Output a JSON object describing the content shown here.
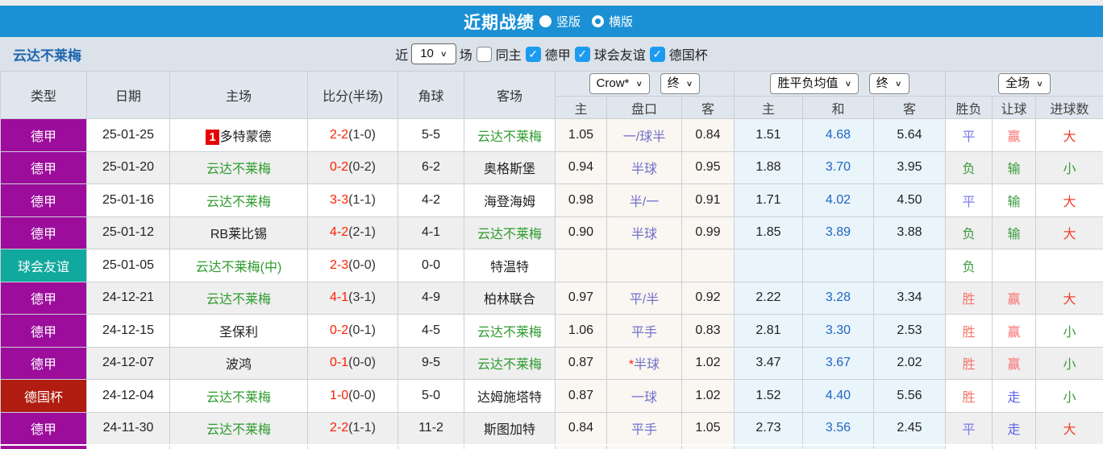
{
  "topbar": {
    "title": "近期战绩",
    "vertical_label": "竖版",
    "horizontal_label": "横版",
    "selected_layout": "竖版"
  },
  "filterbar": {
    "team": "云达不莱梅",
    "recent_label": "近",
    "count_value": "10",
    "matches_label": "场",
    "same_venue_label": "同主",
    "same_venue_checked": false,
    "leagues": [
      {
        "label": "德甲",
        "checked": true
      },
      {
        "label": "球会友谊",
        "checked": true
      },
      {
        "label": "德国杯",
        "checked": true
      }
    ]
  },
  "table": {
    "headers": {
      "type": "类型",
      "date": "日期",
      "home": "主场",
      "score": "比分(半场)",
      "corner": "角球",
      "away": "客场",
      "odds_select": "Crow*",
      "odds_final_select": "终",
      "avg_select": "胜平负均值",
      "avg_final_select": "终",
      "scope_select": "全场",
      "odds_home": "主",
      "odds_name": "盘口",
      "odds_away": "客",
      "avg_home": "主",
      "avg_draw": "和",
      "avg_away": "客",
      "result": "胜负",
      "handicap": "让球",
      "goals": "进球数"
    },
    "rows": [
      {
        "type": "德甲",
        "date": "25-01-25",
        "home": "多特蒙德",
        "home_badge": "1",
        "home_is_focus": false,
        "score_ft": "2-2",
        "score_ht": "(1-0)",
        "corner": "5-5",
        "away": "云达不莱梅",
        "away_is_focus": true,
        "odds_home": "1.05",
        "handicap": "一/球半",
        "handicap_prefix": "",
        "odds_away": "0.84",
        "avg_home": "1.51",
        "avg_draw": "4.68",
        "avg_away": "5.64",
        "result": "平",
        "handicap_result": "赢",
        "goals": "大"
      },
      {
        "type": "德甲",
        "date": "25-01-20",
        "home": "云达不莱梅",
        "home_badge": "",
        "home_is_focus": true,
        "score_ft": "0-2",
        "score_ht": "(0-2)",
        "corner": "6-2",
        "away": "奥格斯堡",
        "away_is_focus": false,
        "odds_home": "0.94",
        "handicap": "半球",
        "handicap_prefix": "",
        "odds_away": "0.95",
        "avg_home": "1.88",
        "avg_draw": "3.70",
        "avg_away": "3.95",
        "result": "负",
        "handicap_result": "输",
        "goals": "小"
      },
      {
        "type": "德甲",
        "date": "25-01-16",
        "home": "云达不莱梅",
        "home_badge": "",
        "home_is_focus": true,
        "score_ft": "3-3",
        "score_ht": "(1-1)",
        "corner": "4-2",
        "away": "海登海姆",
        "away_is_focus": false,
        "odds_home": "0.98",
        "handicap": "半/一",
        "handicap_prefix": "",
        "odds_away": "0.91",
        "avg_home": "1.71",
        "avg_draw": "4.02",
        "avg_away": "4.50",
        "result": "平",
        "handicap_result": "输",
        "goals": "大"
      },
      {
        "type": "德甲",
        "date": "25-01-12",
        "home": "RB莱比锡",
        "home_badge": "",
        "home_is_focus": false,
        "score_ft": "4-2",
        "score_ht": "(2-1)",
        "corner": "4-1",
        "away": "云达不莱梅",
        "away_is_focus": true,
        "odds_home": "0.90",
        "handicap": "半球",
        "handicap_prefix": "",
        "odds_away": "0.99",
        "avg_home": "1.85",
        "avg_draw": "3.89",
        "avg_away": "3.88",
        "result": "负",
        "handicap_result": "输",
        "goals": "大"
      },
      {
        "type": "球会友谊",
        "date": "25-01-05",
        "home": "云达不莱梅(中)",
        "home_badge": "",
        "home_is_focus": true,
        "score_ft": "2-3",
        "score_ht": "(0-0)",
        "corner": "0-0",
        "away": "特温特",
        "away_is_focus": false,
        "odds_home": "",
        "handicap": "",
        "handicap_prefix": "",
        "odds_away": "",
        "avg_home": "",
        "avg_draw": "",
        "avg_away": "",
        "result": "负",
        "handicap_result": "",
        "goals": ""
      },
      {
        "type": "德甲",
        "date": "24-12-21",
        "home": "云达不莱梅",
        "home_badge": "",
        "home_is_focus": true,
        "score_ft": "4-1",
        "score_ht": "(3-1)",
        "corner": "4-9",
        "away": "柏林联合",
        "away_is_focus": false,
        "odds_home": "0.97",
        "handicap": "平/半",
        "handicap_prefix": "",
        "odds_away": "0.92",
        "avg_home": "2.22",
        "avg_draw": "3.28",
        "avg_away": "3.34",
        "result": "胜",
        "handicap_result": "赢",
        "goals": "大"
      },
      {
        "type": "德甲",
        "date": "24-12-15",
        "home": "圣保利",
        "home_badge": "",
        "home_is_focus": false,
        "score_ft": "0-2",
        "score_ht": "(0-1)",
        "corner": "4-5",
        "away": "云达不莱梅",
        "away_is_focus": true,
        "odds_home": "1.06",
        "handicap": "平手",
        "handicap_prefix": "",
        "odds_away": "0.83",
        "avg_home": "2.81",
        "avg_draw": "3.30",
        "avg_away": "2.53",
        "result": "胜",
        "handicap_result": "赢",
        "goals": "小"
      },
      {
        "type": "德甲",
        "date": "24-12-07",
        "home": "波鸿",
        "home_badge": "",
        "home_is_focus": false,
        "score_ft": "0-1",
        "score_ht": "(0-0)",
        "corner": "9-5",
        "away": "云达不莱梅",
        "away_is_focus": true,
        "odds_home": "0.87",
        "handicap": "半球",
        "handicap_prefix": "*",
        "odds_away": "1.02",
        "avg_home": "3.47",
        "avg_draw": "3.67",
        "avg_away": "2.02",
        "result": "胜",
        "handicap_result": "赢",
        "goals": "小"
      },
      {
        "type": "德国杯",
        "date": "24-12-04",
        "home": "云达不莱梅",
        "home_badge": "",
        "home_is_focus": true,
        "score_ft": "1-0",
        "score_ht": "(0-0)",
        "corner": "5-0",
        "away": "达姆施塔特",
        "away_is_focus": false,
        "odds_home": "0.87",
        "handicap": "一球",
        "handicap_prefix": "",
        "odds_away": "1.02",
        "avg_home": "1.52",
        "avg_draw": "4.40",
        "avg_away": "5.56",
        "result": "胜",
        "handicap_result": "走",
        "goals": "小"
      },
      {
        "type": "德甲",
        "date": "24-11-30",
        "home": "云达不莱梅",
        "home_badge": "",
        "home_is_focus": true,
        "score_ft": "2-2",
        "score_ht": "(1-1)",
        "corner": "11-2",
        "away": "斯图加特",
        "away_is_focus": false,
        "odds_home": "0.84",
        "handicap": "平手",
        "handicap_prefix": "",
        "odds_away": "1.05",
        "avg_home": "2.73",
        "avg_draw": "3.56",
        "avg_away": "2.45",
        "result": "平",
        "handicap_result": "走",
        "goals": "大"
      }
    ]
  },
  "colors": {
    "topbar_blue": "#1b90d5",
    "type": {
      "德甲": "#9c0d9c",
      "球会友谊": "#11a89e",
      "德国杯": "#b01c10"
    },
    "focus_team_green": "#2e9b2e",
    "score_red": "#ff1e00",
    "result": {
      "胜": "#f4766b",
      "平": "#7b7be8",
      "负": "#3c9a3c"
    },
    "handicap_result": {
      "赢": "#fa6f6f",
      "走": "#5f5fef",
      "输": "#3c9a3c"
    },
    "goals": {
      "大": "#f04030",
      "小": "#3c9a3c"
    }
  }
}
